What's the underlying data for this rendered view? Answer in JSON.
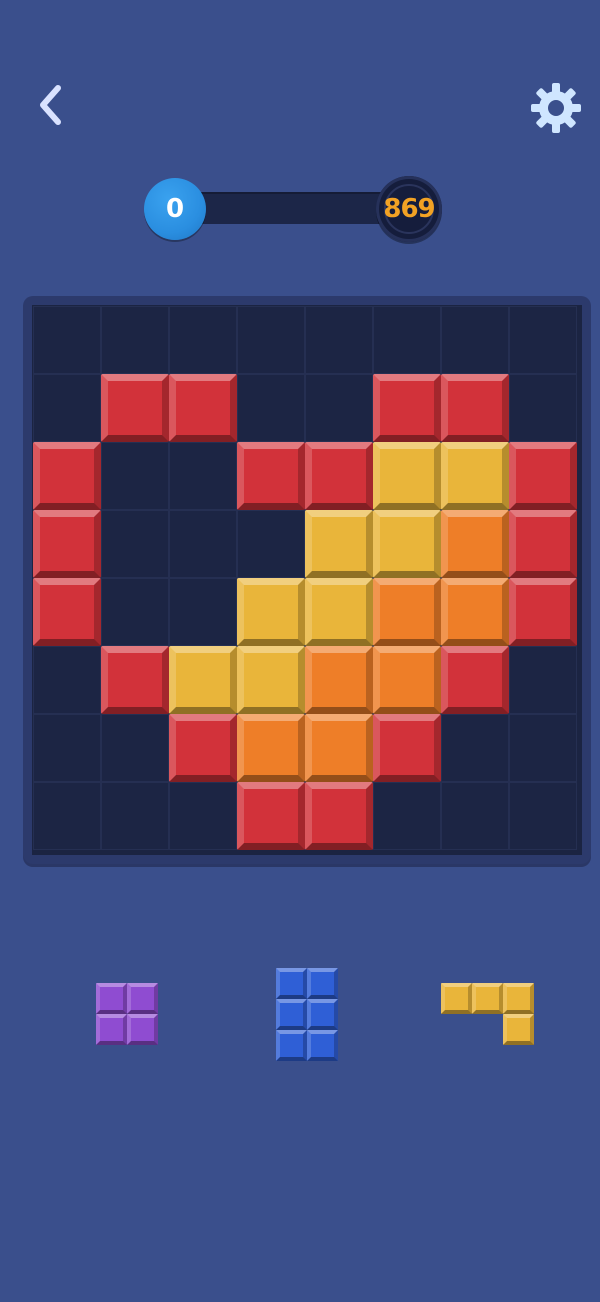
{
  "header": {
    "back_icon": "chevron-left-icon",
    "settings_icon": "gear-icon"
  },
  "progress": {
    "score": "0",
    "target": "869",
    "fill": 0
  },
  "colors": {
    "background": "#3a4f8c",
    "red": "#d2323a",
    "yellow": "#e9b53a",
    "orange": "#ee7e28",
    "purple": "#8f4cd1",
    "blue": "#2f5fd6",
    "score_badge": "#2a8ee0",
    "target_text": "#f2a224"
  },
  "board": {
    "rows": 8,
    "cols": 8,
    "grid": [
      [
        "",
        "",
        "",
        "",
        "",
        "",
        "",
        ""
      ],
      [
        "",
        "red",
        "red",
        "",
        "",
        "red",
        "red",
        ""
      ],
      [
        "red",
        "",
        "",
        "red",
        "red",
        "yellow",
        "yellow",
        "red"
      ],
      [
        "red",
        "",
        "",
        "",
        "yellow",
        "yellow",
        "orange",
        "red"
      ],
      [
        "red",
        "",
        "",
        "yellow",
        "yellow",
        "orange",
        "orange",
        "red"
      ],
      [
        "",
        "red",
        "yellow",
        "yellow",
        "orange",
        "orange",
        "red",
        ""
      ],
      [
        "",
        "",
        "red",
        "orange",
        "orange",
        "red",
        "",
        ""
      ],
      [
        "",
        "",
        "",
        "red",
        "red",
        "",
        "",
        ""
      ]
    ]
  },
  "pieces": [
    {
      "color": "purple",
      "shape": [
        [
          1,
          1
        ],
        [
          1,
          1
        ]
      ]
    },
    {
      "color": "blue",
      "shape": [
        [
          1,
          1
        ],
        [
          1,
          1
        ],
        [
          1,
          1
        ]
      ]
    },
    {
      "color": "yellow",
      "shape": [
        [
          1,
          1,
          1
        ],
        [
          0,
          0,
          1
        ]
      ]
    }
  ]
}
